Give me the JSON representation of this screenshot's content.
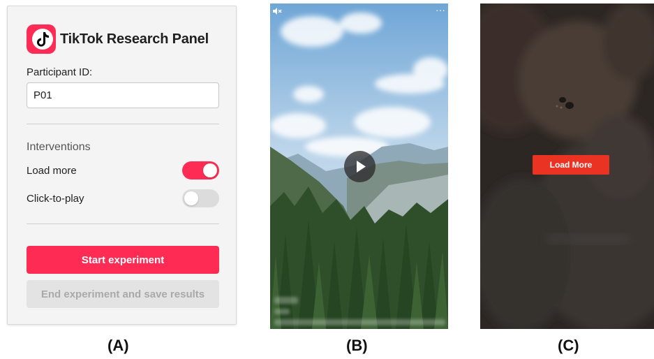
{
  "panel_a": {
    "app_title": "TikTok Research Panel",
    "logo_icon": "tiktok-logo-icon",
    "participant_label": "Participant ID:",
    "participant_value": "P01",
    "interventions_title": "Interventions",
    "toggles": [
      {
        "label": "Load more",
        "state": "on"
      },
      {
        "label": "Click-to-play",
        "state": "off"
      }
    ],
    "start_button": "Start experiment",
    "end_button": "End experiment and save results",
    "accent_color": "#fe2c55"
  },
  "panel_b": {
    "mute_icon": "muted-speaker-icon",
    "more_label": "···",
    "play_icon": "play-icon"
  },
  "panel_c": {
    "load_more_button": "Load More",
    "button_color": "#ea3323"
  },
  "captions": [
    "(A)",
    "(B)",
    "(C)"
  ]
}
